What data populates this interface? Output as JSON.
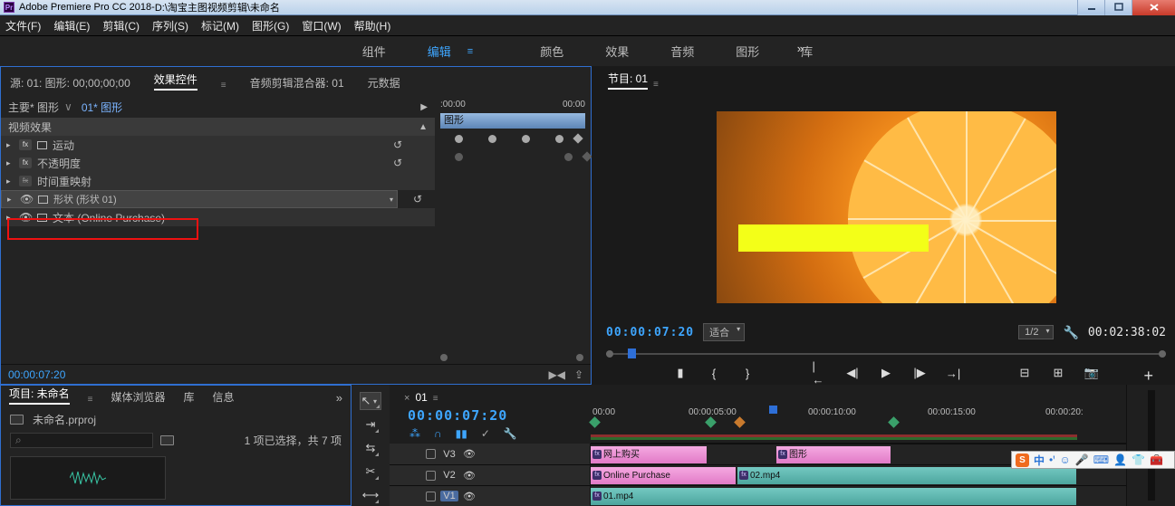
{
  "titlebar": {
    "app": "Adobe Premiere Pro CC 2018",
    "dash": " - ",
    "path": "D:\\淘宝主图视频剪辑\\未命名"
  },
  "menu": [
    "文件(F)",
    "编辑(E)",
    "剪辑(C)",
    "序列(S)",
    "标记(M)",
    "图形(G)",
    "窗口(W)",
    "帮助(H)"
  ],
  "ws": [
    "组件",
    "编辑",
    "颜色",
    "效果",
    "音频",
    "图形",
    "库"
  ],
  "ws_more": "»",
  "srcTabs": {
    "a": "源: 01: 图形: 00;00;00;00",
    "b": "效果控件",
    "c": "音频剪辑混合器: 01",
    "d": "元数据"
  },
  "ec": {
    "master": "主要* 图形",
    "seq": "01* 图形",
    "section": "视频效果",
    "rows": {
      "motion": "运动",
      "opacity": "不透明度",
      "timeremap": "时间重映射",
      "shape": "形状 (形状 01)",
      "text": "文本 (Online Purchase)"
    },
    "footer_tc": "00:00:07:20"
  },
  "ectl": {
    "t0": ":00:00",
    "t1": "00:00",
    "strip": "图形"
  },
  "prog": {
    "tab": "节目: 01",
    "tc": "00:00:07:20",
    "fit": "适合",
    "scale": "1/2",
    "dur": "00:02:38:02"
  },
  "proj": {
    "tabs": [
      "项目: 未命名",
      "媒体浏览器",
      "库",
      "信息"
    ],
    "name": "未命名.prproj",
    "sel": "1 项已选择，共 7 项"
  },
  "tl": {
    "tab": "01",
    "tc": "00:00:07:20",
    "ticks": [
      "00:00",
      "00:00:05:00",
      "00:00:10:00",
      "00:00:15:00",
      "00:00:20:"
    ],
    "tracks": {
      "v3": "V3",
      "v2": "V2",
      "v1": "V1"
    },
    "clips": {
      "v3a": "网上购买",
      "v3b": "图形",
      "v2a": "Online Purchase",
      "v2b": "02.mp4",
      "v1a": "01.mp4"
    }
  },
  "ime": {
    "zh": "中"
  }
}
